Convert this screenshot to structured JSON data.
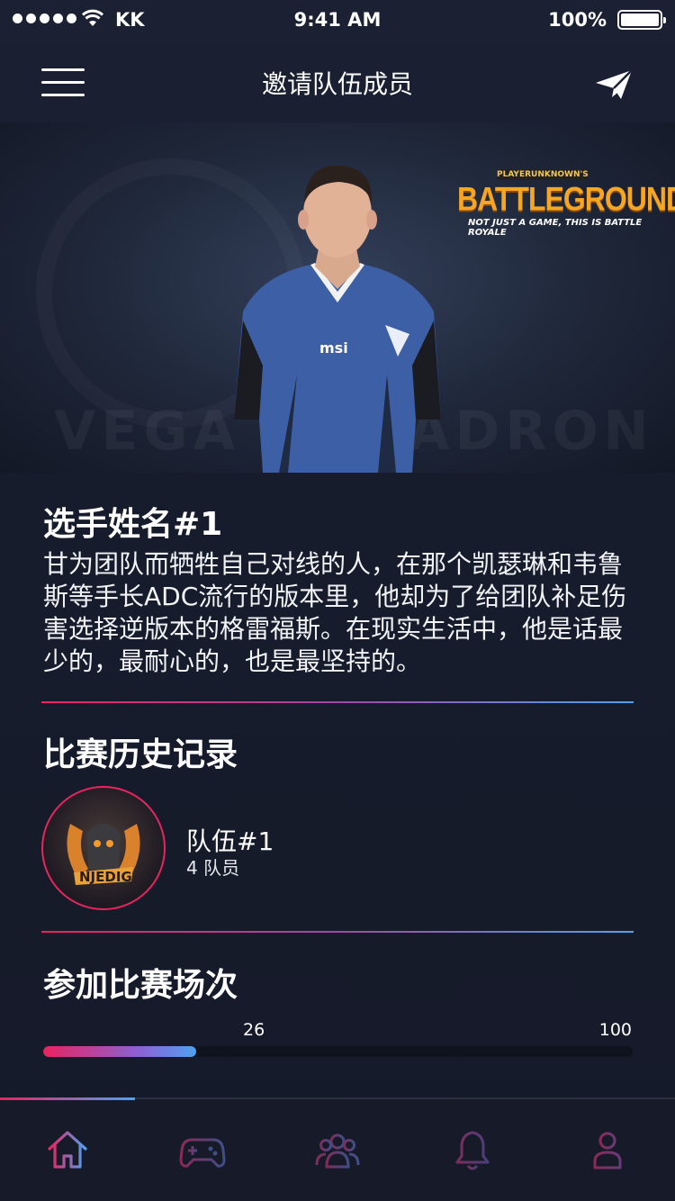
{
  "status_bar": {
    "carrier": "KK",
    "time": "9:41 AM",
    "battery": "100%"
  },
  "nav": {
    "title": "邀请队伍成员",
    "menu_icon": "hamburger-menu-icon",
    "send_icon": "paper-plane-icon"
  },
  "hero": {
    "game_logo_top": "PLAYERUNKNOWN'S",
    "game_logo_main": "BATTLEGROUNDS",
    "game_logo_tagline": "NOT JUST A GAME, THIS IS BATTLE ROYALE",
    "jersey_sponsor": "msi",
    "background_text": "VEGA SQUADRON"
  },
  "player": {
    "name": "选手姓名#1",
    "description": "甘为团队而牺牲自己对线的人，在那个凯瑟琳和韦鲁斯等手长ADC流行的版本里，他却为了给团队补足伤害选择逆版本的格雷福斯。在现实生活中，他是话最少的，最耐心的，也是最坚持的。"
  },
  "match_history": {
    "title": "比赛历史记录",
    "team": {
      "name": "队伍#1",
      "members": "4 队员",
      "logo_text": "NJEDIG"
    }
  },
  "matches_joined": {
    "title": "参加比赛场次",
    "current": "26",
    "max": "100",
    "progress": 0.26
  },
  "tab_bar": {
    "active_index": 0,
    "tabs": [
      {
        "icon": "home-icon"
      },
      {
        "icon": "gamepad-icon"
      },
      {
        "icon": "team-icon"
      },
      {
        "icon": "bell-icon"
      },
      {
        "icon": "profile-icon"
      }
    ]
  },
  "colors": {
    "accent_pink": "#e8245f",
    "accent_blue": "#4da2f0",
    "background": "#171c2c"
  }
}
